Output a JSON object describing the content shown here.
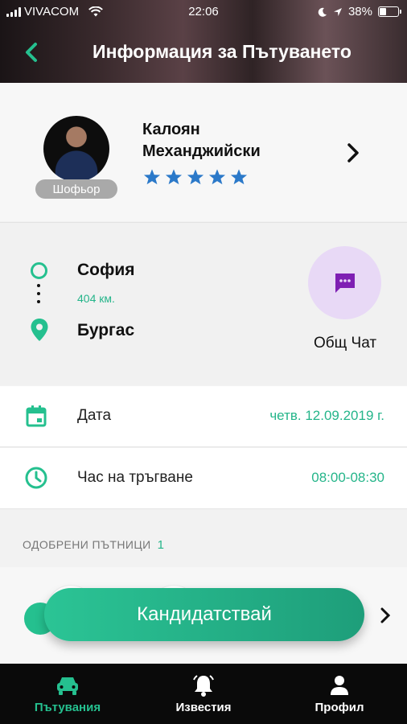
{
  "status_bar": {
    "carrier": "VIVACOM",
    "time": "22:06",
    "battery": "38%"
  },
  "header": {
    "title": "Информация за Пътуването"
  },
  "driver": {
    "name": "Калоян Механджийски",
    "role": "Шофьор",
    "rating": 5
  },
  "route": {
    "from": "София",
    "distance": "404 км.",
    "to": "Бургас"
  },
  "chat": {
    "label": "Общ Чат"
  },
  "details": {
    "date_label": "Дата",
    "date_value": "четв. 12.09.2019 г.",
    "time_label": "Час на тръгване",
    "time_value": "08:00-08:30"
  },
  "passengers": {
    "title": "ОДОБРЕНИ ПЪТНИЦИ",
    "count": "1"
  },
  "apply_button": {
    "label": "Кандидатствай"
  },
  "tabs": [
    {
      "label": "Пътувания",
      "icon": "car-icon",
      "active": true
    },
    {
      "label": "Известия",
      "icon": "bell-icon",
      "active": false
    },
    {
      "label": "Профил",
      "icon": "profile-icon",
      "active": false
    }
  ],
  "colors": {
    "accent": "#25c08f",
    "chat_bg": "#e8d9f6",
    "chat_icon": "#7e1fb3",
    "star": "#2b79c9"
  }
}
